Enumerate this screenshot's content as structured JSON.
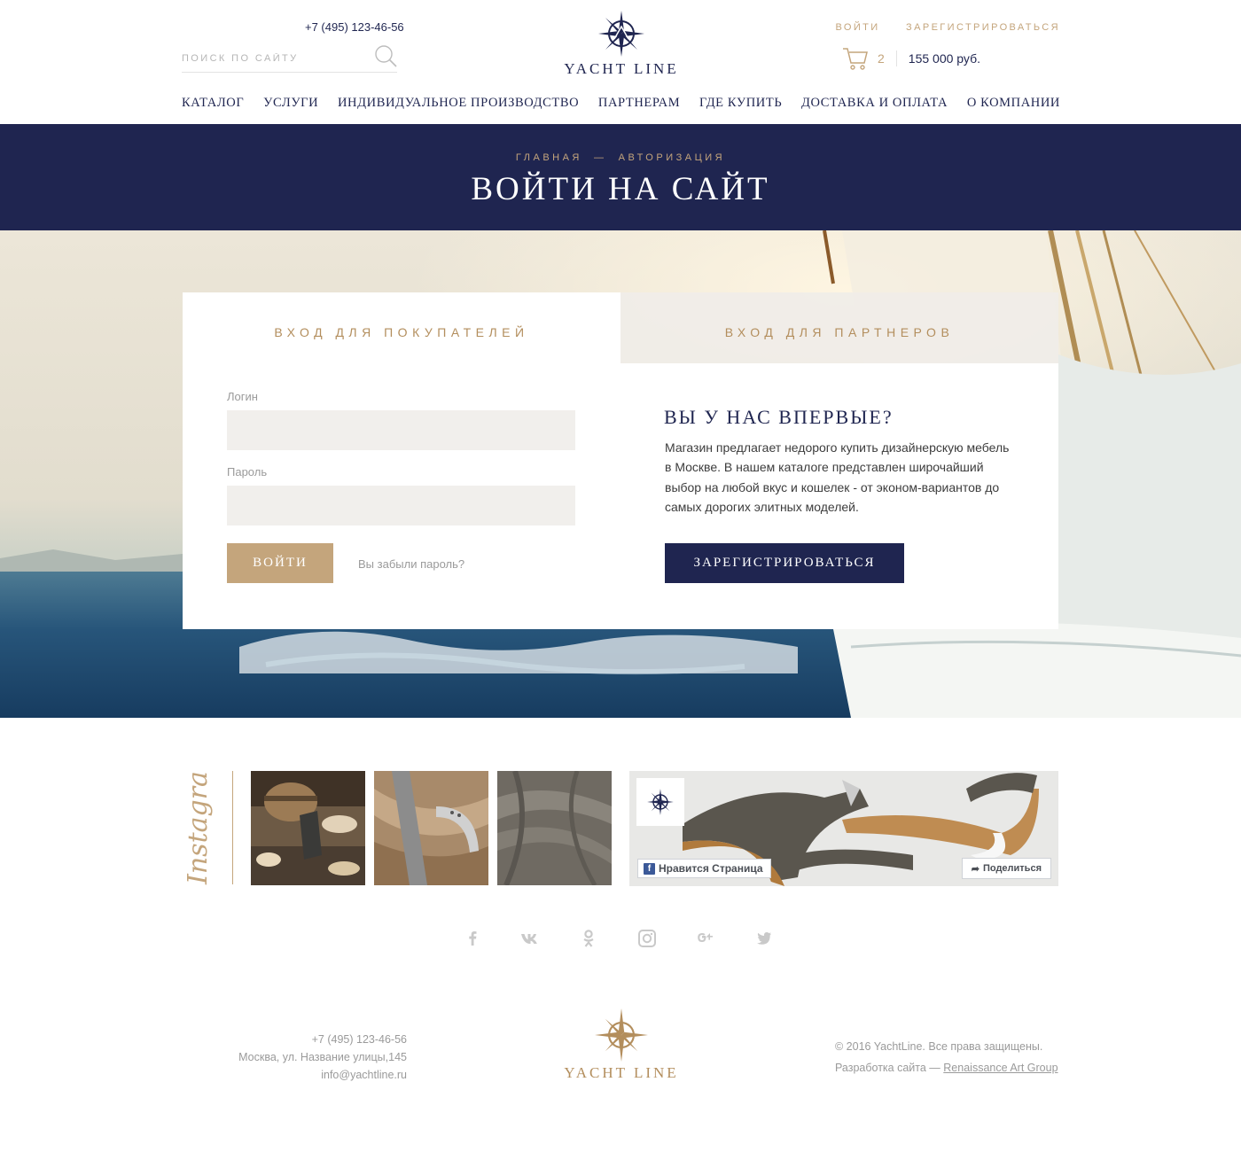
{
  "header": {
    "phone": "+7 (495) 123-46-56",
    "search_placeholder": "ПОИСК ПО САЙТУ",
    "logo_text": "YACHT LINE",
    "login_link": "ВОЙТИ",
    "register_link": "ЗАРЕГИСТРИРОВАТЬСЯ",
    "cart_count": "2",
    "cart_total": "155 000 руб."
  },
  "nav": [
    {
      "label": "КАТАЛОГ"
    },
    {
      "label": "УСЛУГИ"
    },
    {
      "label": "ИНДИВИДУАЛЬНОЕ ПРОИЗВОДСТВО"
    },
    {
      "label": "ПАРТНЕРАМ"
    },
    {
      "label": "ГДЕ КУПИТЬ"
    },
    {
      "label": "ДОСТАВКА И ОПЛАТА"
    },
    {
      "label": "О КОМПАНИИ"
    }
  ],
  "breadcrumb": {
    "home": "ГЛАВНАЯ",
    "separator": "—",
    "current": "АВТОРИЗАЦИЯ"
  },
  "page_title": "ВОЙТИ НА САЙТ",
  "login": {
    "tab_buyers": "ВХОД ДЛЯ ПОКУПАТЕЛЕЙ",
    "tab_partners": "ВХОД ДЛЯ ПАРТНЕРОВ",
    "login_label": "Логин",
    "login_value": "",
    "password_label": "Пароль",
    "password_value": "",
    "submit_label": "ВОЙТИ",
    "forgot_label": "Вы забыли пароль?"
  },
  "new_customer": {
    "title": "ВЫ У НАС ВПЕРВЫЕ?",
    "text": "Магазин предлагает недорого купить дизайнерскую мебель в Москве. В нашем каталоге представлен широчайший выбор на любой вкус и кошелек - от эконом-вариантов до самых дорогих элитных моделей.",
    "register_label": "ЗАРЕГИСТРИРОВАТЬСЯ"
  },
  "instagram": {
    "label": "Instagram"
  },
  "facebook": {
    "like_label": "Нравится Страница",
    "share_label": "Поделиться"
  },
  "socials": [
    {
      "icon": "facebook-icon",
      "glyph": "f"
    },
    {
      "icon": "vk-icon",
      "glyph": "vk"
    },
    {
      "icon": "odnoklassniki-icon",
      "glyph": "ok"
    },
    {
      "icon": "instagram-icon",
      "glyph": "ig"
    },
    {
      "icon": "google-plus-icon",
      "glyph": "g+"
    },
    {
      "icon": "twitter-icon",
      "glyph": "tw"
    }
  ],
  "footer": {
    "phone": "+7 (495) 123-46-56",
    "address": "Москва, ул. Название улицы,145",
    "email": "info@yachtline.ru",
    "logo_text": "YACHT LINE",
    "copyright": "© 2016 YachtLine. Все права защищены.",
    "dev_prefix": "Разработка сайта —",
    "dev_link": "Renaissance Art Group"
  },
  "colors": {
    "navy": "#1f2550",
    "gold": "#c4a57c",
    "field_bg": "#f1efec",
    "muted_text": "#9a9a9a"
  }
}
